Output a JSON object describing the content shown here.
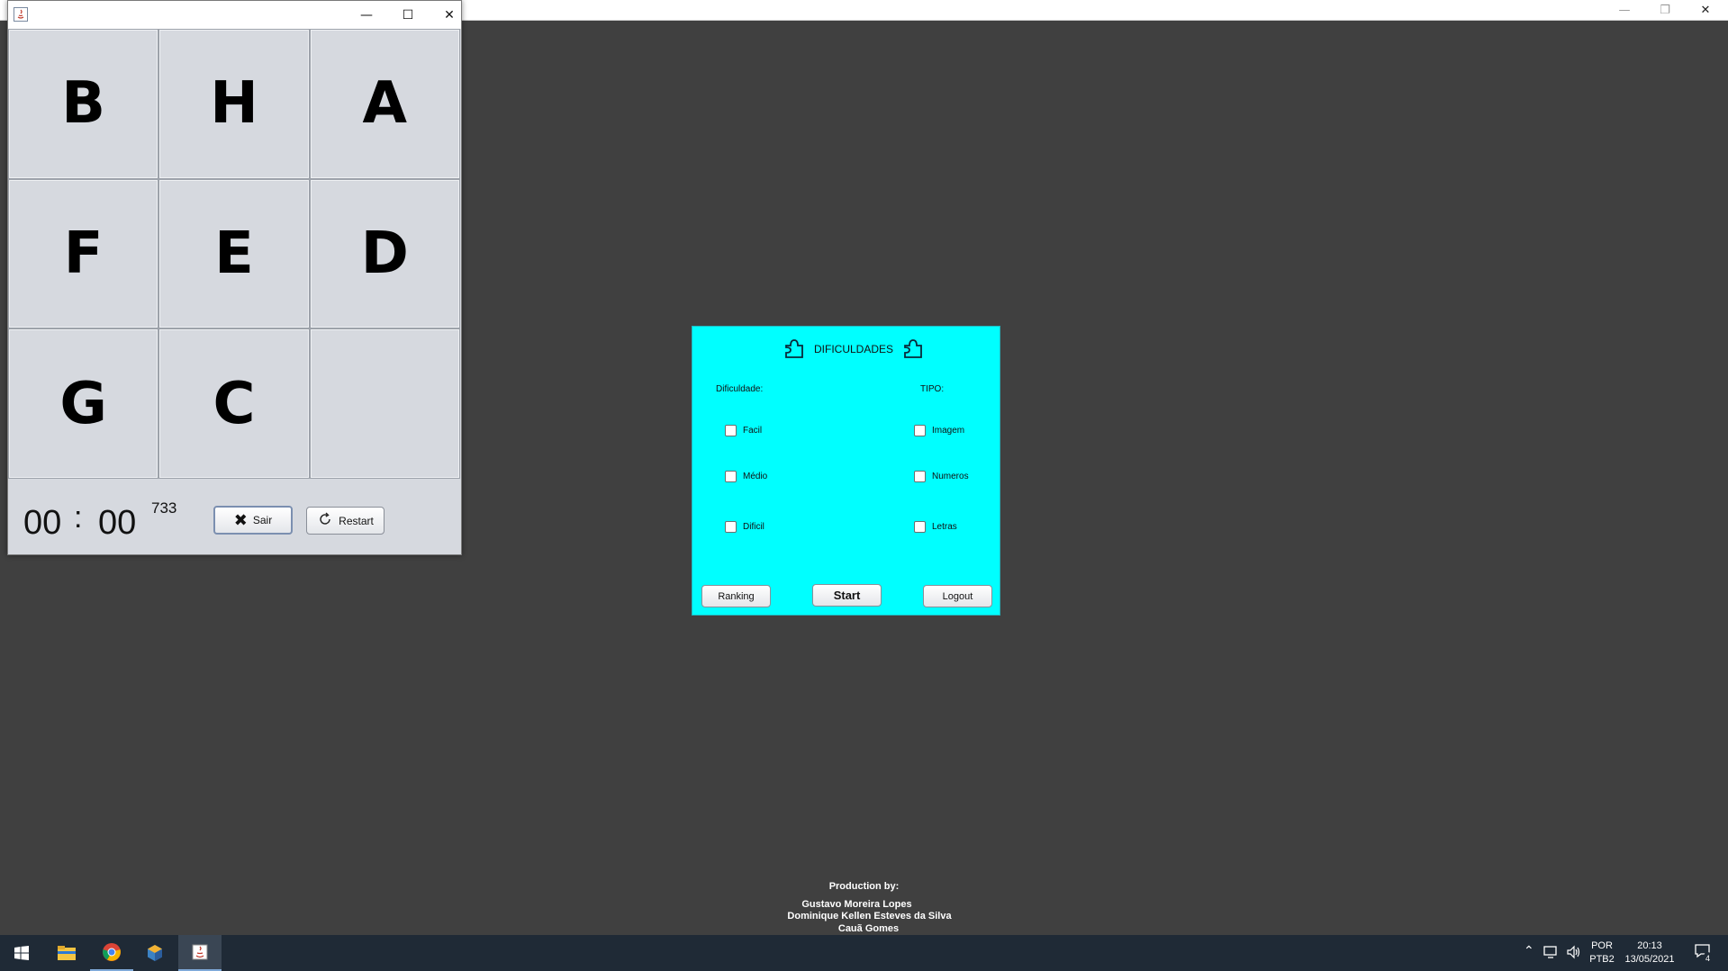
{
  "puzzle": {
    "tiles": [
      "B",
      "H",
      "A",
      "F",
      "E",
      "D",
      "G",
      "C",
      ""
    ],
    "timer": {
      "minutes": "00",
      "separator": ":",
      "seconds": "00",
      "count": "733"
    },
    "buttons": {
      "exit_label": "Sair",
      "restart_label": "Restart"
    }
  },
  "dialog": {
    "title": "DIFICULDADES",
    "difficulty_heading": "Dificuldade:",
    "type_heading": "TIPO:",
    "difficulty_options": [
      "Facil",
      "Médio",
      "Dificil"
    ],
    "type_options": [
      "Imagem",
      "Numeros",
      "Letras"
    ],
    "buttons": {
      "ranking": "Ranking",
      "start": "Start",
      "logout": "Logout"
    },
    "background_color": "#00ffff"
  },
  "credits": {
    "heading": "Production by:",
    "names": [
      "Gustavo Moreira Lopes",
      "Dominique Kellen Esteves da Silva",
      "Cauã Gomes"
    ]
  },
  "taskbar": {
    "language": "POR",
    "layout": "PTB2",
    "time": "20:13",
    "date": "13/05/2021",
    "notifications": "4"
  }
}
